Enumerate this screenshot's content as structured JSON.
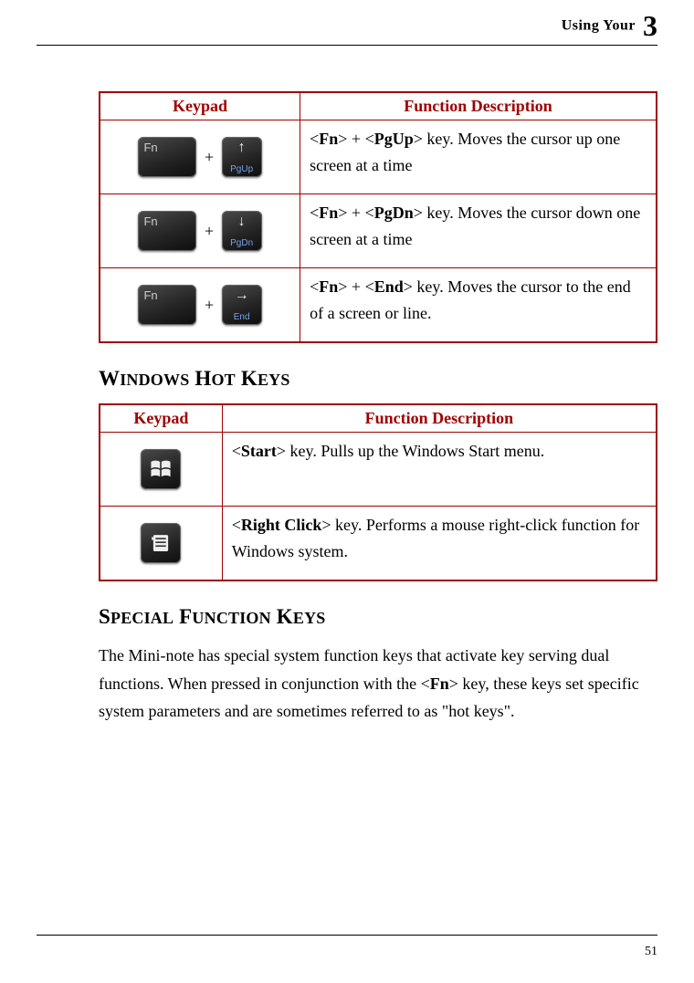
{
  "header": {
    "chapter_label": "Using Your",
    "chapter_number": "3"
  },
  "table1": {
    "col_keypad": "Keypad",
    "col_desc": "Function Description",
    "rows": [
      {
        "fn_label": "Fn",
        "plus": "+",
        "key2_top": "↑",
        "key2_bottom": "PgUp",
        "desc_pre": "<",
        "desc_fn": "Fn",
        "desc_mid1": "> + <",
        "desc_key": "PgUp",
        "desc_mid2": "> key. Moves the cursor up one screen at a time"
      },
      {
        "fn_label": "Fn",
        "plus": "+",
        "key2_top": "↓",
        "key2_bottom": "PgDn",
        "desc_pre": "<",
        "desc_fn": "Fn",
        "desc_mid1": "> + <",
        "desc_key": "PgDn",
        "desc_mid2": "> key. Moves the cursor down one screen at a time"
      },
      {
        "fn_label": "Fn",
        "plus": "+",
        "key2_top": "→",
        "key2_bottom": "End",
        "desc_pre": "<",
        "desc_fn": "Fn",
        "desc_mid1": "> + <",
        "desc_key": "End",
        "desc_mid2": "> key. Moves the cursor to the end of a screen or line."
      }
    ]
  },
  "heading1": {
    "w": "W",
    "w_rest": "INDOWS",
    "h": "H",
    "h_rest": "OT",
    "k": "K",
    "k_rest": "EYS"
  },
  "table2": {
    "col_keypad": "Keypad",
    "col_desc": "Function Description",
    "rows": [
      {
        "icon": "windows",
        "desc_pre": "<",
        "desc_key": "Start",
        "desc_post": "> key. Pulls up the Windows Start menu."
      },
      {
        "icon": "menu",
        "desc_pre": "<",
        "desc_key": "Right Click",
        "desc_post": "> key. Performs a mouse right-click function for Windows system."
      }
    ]
  },
  "heading2": {
    "s": "S",
    "s_rest": "PECIAL",
    "f": "F",
    "f_rest": "UNCTION",
    "k": "K",
    "k_rest": "EYS"
  },
  "paragraph": {
    "p1": "The Mini-note has special system function keys that activate key serving dual functions. When pressed in conjunction with the <",
    "fn": "Fn",
    "p2": "> key, these keys set specific system parameters and are sometimes referred to as \"hot keys\"."
  },
  "page_number": "51"
}
